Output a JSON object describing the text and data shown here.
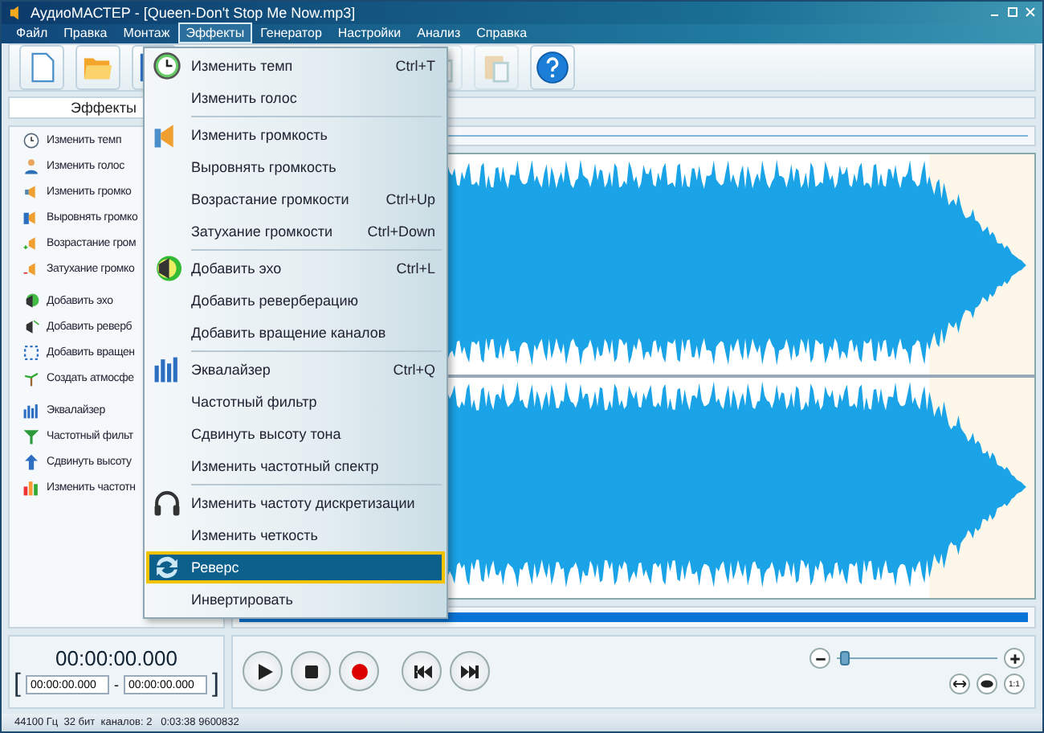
{
  "window": {
    "title": "АудиоМАСТЕР - [Queen-Don't Stop Me Now.mp3]"
  },
  "menubar": [
    {
      "label": "Файл",
      "selected": false
    },
    {
      "label": "Правка",
      "selected": false
    },
    {
      "label": "Монтаж",
      "selected": false
    },
    {
      "label": "Эффекты",
      "selected": true
    },
    {
      "label": "Генератор",
      "selected": false
    },
    {
      "label": "Настройки",
      "selected": false
    },
    {
      "label": "Анализ",
      "selected": false
    },
    {
      "label": "Справка",
      "selected": false
    }
  ],
  "toolbar": [
    {
      "kind": "new",
      "disabled": false
    },
    {
      "kind": "open",
      "disabled": false
    },
    {
      "kind": "save",
      "disabled": false
    },
    {
      "kind": "gap"
    },
    {
      "kind": "copy",
      "disabled": true
    },
    {
      "kind": "paste",
      "disabled": true
    },
    {
      "kind": "help",
      "disabled": false
    }
  ],
  "left_panel": {
    "tab": "Эффекты",
    "groups": [
      [
        {
          "label": "Изменить темп"
        },
        {
          "label": "Изменить голос"
        },
        {
          "label": "Изменить громко"
        },
        {
          "label": "Выровнять громко"
        },
        {
          "label": "Возрастание гром"
        },
        {
          "label": "Затухание громко"
        }
      ],
      [
        {
          "label": "Добавить эхо"
        },
        {
          "label": "Добавить реверб"
        },
        {
          "label": "Добавить вращен"
        },
        {
          "label": "Создать атмосфе"
        }
      ],
      [
        {
          "label": "Эквалайзер"
        },
        {
          "label": "Частотный фильт"
        },
        {
          "label": "Сдвинуть высоту"
        },
        {
          "label": "Изменить частотн"
        }
      ]
    ]
  },
  "effects_menu": {
    "groups": [
      [
        {
          "label": "Изменить темп",
          "shortcut": "Ctrl+T",
          "selected": false
        },
        {
          "label": "Изменить голос",
          "selected": false
        }
      ],
      [
        {
          "label": "Изменить громкость",
          "selected": false
        },
        {
          "label": "Выровнять громкость",
          "selected": false
        },
        {
          "label": "Возрастание громкости",
          "shortcut": "Ctrl+Up",
          "selected": false
        },
        {
          "label": "Затухание громкости",
          "shortcut": "Ctrl+Down",
          "selected": false
        }
      ],
      [
        {
          "label": "Добавить эхо",
          "shortcut": "Ctrl+L",
          "selected": false
        },
        {
          "label": "Добавить реверберацию",
          "selected": false
        },
        {
          "label": "Добавить вращение каналов",
          "selected": false
        }
      ],
      [
        {
          "label": "Эквалайзер",
          "shortcut": "Ctrl+Q",
          "selected": false
        },
        {
          "label": "Частотный фильтр",
          "selected": false
        },
        {
          "label": "Сдвинуть высоту тона",
          "selected": false
        },
        {
          "label": "Изменить частотный спектр",
          "selected": false
        }
      ],
      [
        {
          "label": "Изменить частоту дискретизации",
          "selected": false
        },
        {
          "label": "Изменить четкость",
          "selected": false
        },
        {
          "label": "Реверс",
          "selected": true
        },
        {
          "label": "Инвертировать",
          "selected": false
        }
      ]
    ]
  },
  "time": {
    "current": "00:00:00.000",
    "bracket_open": "[",
    "start": "00:00:00.000",
    "dash": "-",
    "end": "00:00:00.000",
    "bracket_close": "]"
  },
  "zoom": {
    "level": 0.02,
    "fit_buttons": [
      {
        "kind": "fit"
      },
      {
        "kind": "view"
      },
      {
        "kind": "one",
        "label": "1:1"
      }
    ]
  },
  "status_bar": "44100 Гц  32 бит  каналов: 2   0:03:38 9600832"
}
